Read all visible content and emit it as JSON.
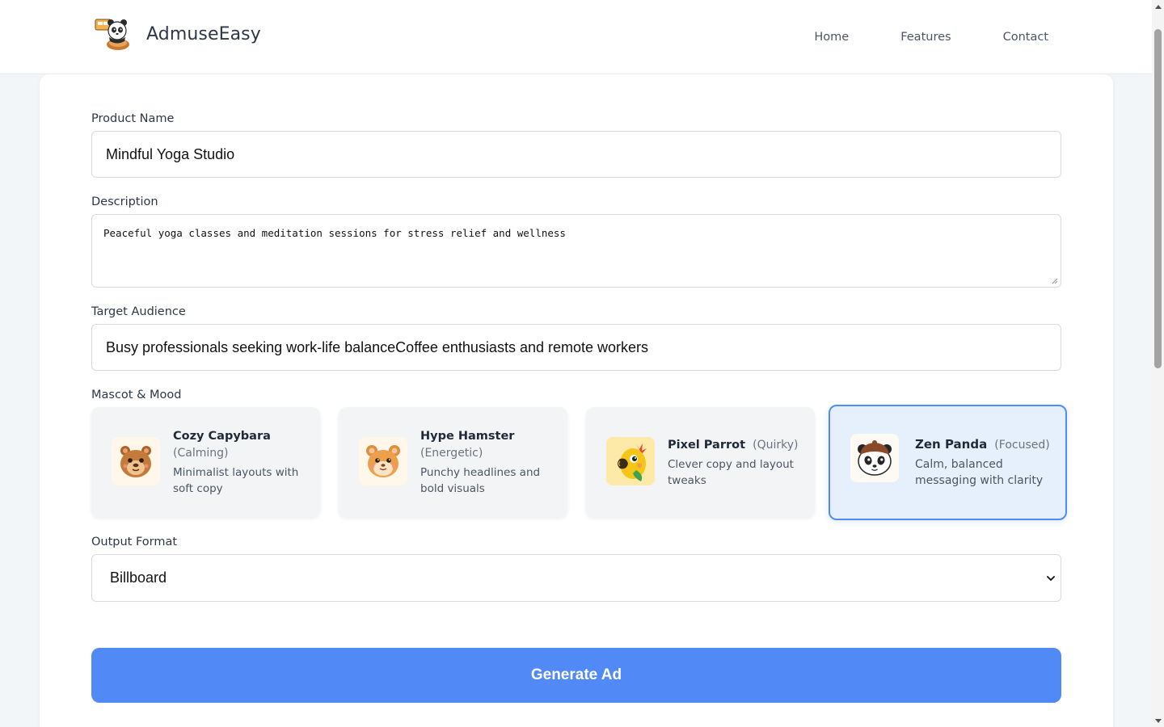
{
  "nav": {
    "brand": "AdmuseEasy",
    "logo_icon": "panda-mascot-logo",
    "links": [
      "Home",
      "Features",
      "Contact"
    ]
  },
  "form": {
    "product_name": {
      "label": "Product Name",
      "value": "Mindful Yoga Studio"
    },
    "description": {
      "label": "Description",
      "value": "Peaceful yoga classes and meditation sessions for stress relief and wellness"
    },
    "target_audience": {
      "label": "Target Audience",
      "value": "Busy professionals seeking work-life balanceCoffee enthusiasts and remote workers"
    },
    "mascot_section": {
      "label": "Mascot & Mood"
    },
    "mascots": [
      {
        "name": "Cozy Capybara",
        "mood": "(Calming)",
        "desc": "Minimalist layouts with soft copy",
        "icon": "capybara-icon",
        "selected": false
      },
      {
        "name": "Hype Hamster",
        "mood": "(Energetic)",
        "desc": "Punchy headlines and bold visuals",
        "icon": "hamster-icon",
        "selected": false
      },
      {
        "name": "Pixel Parrot",
        "mood": "(Quirky)",
        "desc": "Clever copy and layout tweaks",
        "icon": "parrot-icon",
        "selected": false
      },
      {
        "name": "Zen Panda",
        "mood": "(Focused)",
        "desc": "Calm, balanced messaging with clarity",
        "icon": "panda-icon",
        "selected": true
      }
    ],
    "output_format": {
      "label": "Output Format",
      "value": "Billboard"
    },
    "generate_label": "Generate Ad"
  },
  "colors": {
    "accent": "#5189f6",
    "selected_border": "#4f8cf7",
    "selected_bg": "#e6f0fd"
  }
}
